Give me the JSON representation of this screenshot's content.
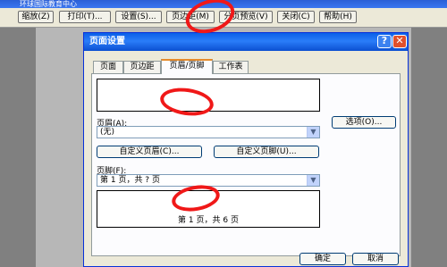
{
  "app": {
    "title": "环球国际教育中心"
  },
  "toolbar": {
    "zoom": "缩放(Z)",
    "print": "打印(T)...",
    "setup": "设置(S)...",
    "margins": "页边距(M)",
    "page_break_preview": "分页预览(V)",
    "close": "关闭(C)",
    "help": "帮助(H)"
  },
  "dialog": {
    "title": "页面设置",
    "help_btn": "?",
    "close_btn": "✕",
    "tabs": [
      "页面",
      "页边距",
      "页眉/页脚",
      "工作表"
    ],
    "header_label": "页眉(A):",
    "header_value": "(无)",
    "options_button": "选项(O)...",
    "custom_header_button": "自定义页眉(C)...",
    "custom_footer_button": "自定义页脚(U)...",
    "footer_label": "页脚(F):",
    "footer_value": "第 1 页，共 ? 页",
    "footer_preview": "第 1 页，共 6 页",
    "ok_button": "确定",
    "cancel_button": "取消"
  },
  "colors": {
    "annotation": "#f01818",
    "title_bar": "#0a5fe8"
  }
}
